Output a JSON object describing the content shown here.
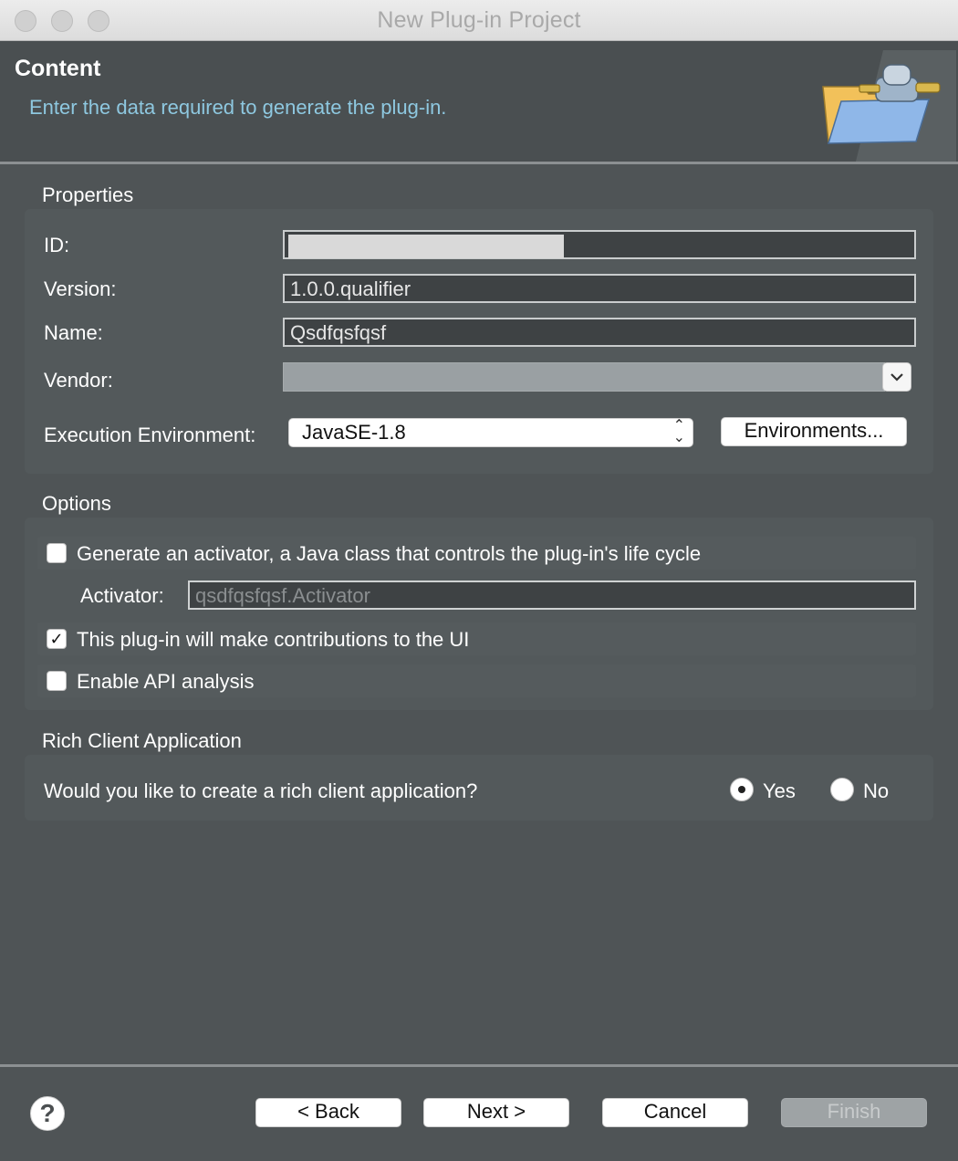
{
  "window": {
    "title": "New Plug-in Project"
  },
  "banner": {
    "heading": "Content",
    "subtitle": "Enter the data required to generate the plug-in."
  },
  "properties": {
    "section_label": "Properties",
    "id_label": "ID:",
    "id_value": "",
    "version_label": "Version:",
    "version_value": "1.0.0.qualifier",
    "name_label": "Name:",
    "name_value": "Qsdfqsfqsf",
    "vendor_label": "Vendor:",
    "vendor_value": "",
    "exec_env_label": "Execution Environment:",
    "exec_env_value": "JavaSE-1.8",
    "environments_button": "Environments..."
  },
  "options": {
    "section_label": "Options",
    "generate_activator": {
      "label": "Generate an activator, a Java class that controls the plug-in's life cycle",
      "checked": false
    },
    "activator_label": "Activator:",
    "activator_value": "qsdfqsfqsf.Activator",
    "ui_contributions": {
      "label": "This plug-in will make contributions to the UI",
      "checked": true
    },
    "api_analysis": {
      "label": "Enable API analysis",
      "checked": false
    }
  },
  "rca": {
    "section_label": "Rich Client Application",
    "question": "Would you like to create a rich client application?",
    "yes_label": "Yes",
    "no_label": "No",
    "selected": "Yes"
  },
  "footer": {
    "help_glyph": "?",
    "back_label": "< Back",
    "next_label": "Next >",
    "cancel_label": "Cancel",
    "finish_label": "Finish"
  },
  "colors": {
    "background": "#4f5456",
    "subtitle": "#8ec8e0",
    "field_bg": "#3e4244"
  }
}
